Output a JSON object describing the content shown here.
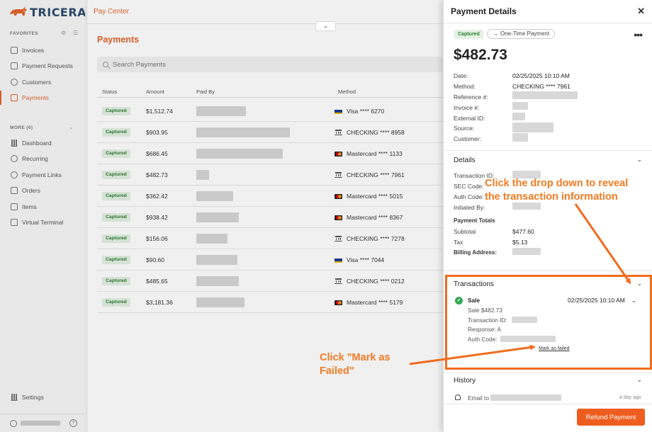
{
  "app": {
    "brand": "TRICERA",
    "section": "Pay Center"
  },
  "sidebar": {
    "favorites_label": "FAVORITES",
    "favorites": [
      {
        "label": "Invoices",
        "icon": "invoice-icon"
      },
      {
        "label": "Payment Requests",
        "icon": "payment-request-icon"
      },
      {
        "label": "Customers",
        "icon": "customers-icon"
      },
      {
        "label": "Payments",
        "icon": "payments-icon",
        "active": true
      }
    ],
    "more_label": "MORE (6)",
    "more": [
      {
        "label": "Dashboard",
        "icon": "dashboard-icon"
      },
      {
        "label": "Recurring",
        "icon": "recurring-icon"
      },
      {
        "label": "Payment Links",
        "icon": "link-icon"
      },
      {
        "label": "Orders",
        "icon": "orders-icon"
      },
      {
        "label": "Items",
        "icon": "items-icon"
      },
      {
        "label": "Virtual Terminal",
        "icon": "terminal-icon"
      }
    ],
    "settings_label": "Settings",
    "help_glyph": "?"
  },
  "main": {
    "title": "Payments",
    "search_placeholder": "Search Payments",
    "columns": {
      "status": "Status",
      "amount": "Amount",
      "paid_by": "Paid By",
      "method": "Method"
    },
    "rows": [
      {
        "status": "Captured",
        "amount": "$1,512.74",
        "method": "Visa **** 6270",
        "method_type": "visa"
      },
      {
        "status": "Captured",
        "amount": "$903.95",
        "method": "CHECKING **** 8958",
        "method_type": "bank"
      },
      {
        "status": "Captured",
        "amount": "$686.45",
        "method": "Mastercard **** 1133",
        "method_type": "mastercard"
      },
      {
        "status": "Captured",
        "amount": "$482.73",
        "method": "CHECKING **** 7961",
        "method_type": "bank"
      },
      {
        "status": "Captured",
        "amount": "$362.42",
        "method": "Mastercard **** 5015",
        "method_type": "mastercard"
      },
      {
        "status": "Captured",
        "amount": "$938.42",
        "method": "Mastercard **** 8367",
        "method_type": "mastercard"
      },
      {
        "status": "Captured",
        "amount": "$156.06",
        "method": "CHECKING **** 7278",
        "method_type": "bank"
      },
      {
        "status": "Captured",
        "amount": "$90.60",
        "method": "Visa **** 7044",
        "method_type": "visa"
      },
      {
        "status": "Captured",
        "amount": "$485.65",
        "method": "CHECKING **** 0212",
        "method_type": "bank"
      },
      {
        "status": "Captured",
        "amount": "$3,181.36",
        "method": "Mastercard **** 5179",
        "method_type": "mastercard"
      }
    ]
  },
  "panel": {
    "title": "Payment Details",
    "close_glyph": "✕",
    "status": "Captured",
    "payment_type": "One-Time Payment",
    "menu_glyph": "•••",
    "amount": "$482.73",
    "fields": {
      "date_label": "Date:",
      "date": "02/25/2025 10:10 AM",
      "method_label": "Method:",
      "method": "CHECKING **** 7961",
      "reference_label": "Reference #:",
      "invoice_label": "Invoice #:",
      "external_label": "External ID:",
      "source_label": "Source:",
      "customer_label": "Customer:"
    },
    "details": {
      "title": "Details",
      "transaction_id_label": "Transaction ID:",
      "sec_code_label": "SEC Code:",
      "auth_code_label": "Auth Code:",
      "initiated_by_label": "Initiated By:",
      "totals_title": "Payment Totals",
      "subtotal_label": "Subtotal",
      "subtotal": "$477.60",
      "tax_label": "Tax",
      "tax": "$5.13",
      "billing_label": "Billing Address:"
    },
    "transactions": {
      "title": "Transactions",
      "type": "Sale",
      "date": "02/25/2025 10:10 AM",
      "amount_line": "Sale $482.73",
      "transaction_id_label": "Transaction ID:",
      "response_line": "Response: A",
      "auth_code_label": "Auth Code:",
      "mark_failed": "Mark as failed"
    },
    "history": {
      "title": "History",
      "email_label": "Email to",
      "time": "a day ago"
    },
    "refund_label": "Refund Payment"
  },
  "annotations": {
    "dropdown_hint": [
      "Click the drop down to reveal",
      "the transaction information"
    ],
    "mark_failed_hint": [
      "Click \"Mark as",
      "Failed\""
    ],
    "color": "#f47a22"
  },
  "colors": {
    "accent": "#e4642b",
    "captured_bg": "#e3f1e3",
    "captured_fg": "#2e7d32",
    "refund": "#ef5d1e"
  }
}
